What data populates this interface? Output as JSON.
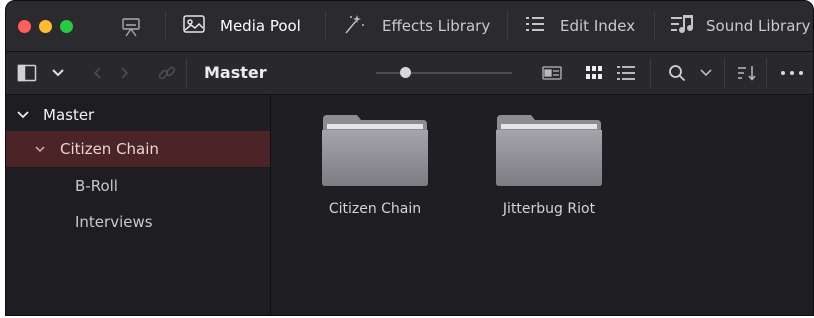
{
  "window": {
    "colors": {
      "close": "#ff5f57",
      "minimize": "#febc2e",
      "zoom": "#28c840"
    }
  },
  "tabs": [
    {
      "label": "Media Pool",
      "icon": "media-pool-icon",
      "active": true
    },
    {
      "label": "Effects Library",
      "icon": "magic-wand-icon",
      "active": false
    },
    {
      "label": "Edit Index",
      "icon": "list-icon",
      "active": false
    },
    {
      "label": "Sound Library",
      "icon": "music-list-icon",
      "active": false
    }
  ],
  "toolbar": {
    "breadcrumb": "Master",
    "icons": [
      "sidebar-toggle-icon",
      "chevron-down-icon",
      "back-arrow-icon",
      "forward-arrow-icon",
      "link-icon",
      "metadata-view-icon",
      "thumbnail-view-icon",
      "list-view-icon",
      "search-icon",
      "sort-icon",
      "more-icon"
    ]
  },
  "sidebar": {
    "items": [
      {
        "label": "Master",
        "expanded": true
      },
      {
        "label": "Citizen Chain",
        "expanded": true,
        "selected": true
      },
      {
        "label": "B-Roll"
      },
      {
        "label": "Interviews"
      }
    ]
  },
  "bins": [
    {
      "label": "Citizen Chain"
    },
    {
      "label": "Jitterbug Riot"
    }
  ],
  "accent": {
    "selection": "#4a2427"
  }
}
